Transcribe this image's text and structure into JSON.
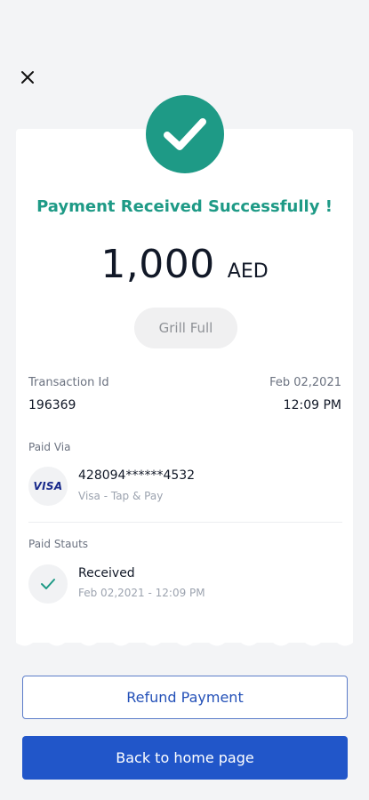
{
  "header": {
    "close_icon": "close-icon"
  },
  "status": {
    "icon": "check-circle-icon",
    "title": "Payment Received Successfully !",
    "color": "#1e9a86"
  },
  "amount": {
    "value": "1,000",
    "currency": "AED"
  },
  "merchant": {
    "name": "Grill Full"
  },
  "transaction": {
    "id_label": "Transaction Id",
    "id_value": "196369",
    "date": "Feb 02,2021",
    "time": "12:09 PM"
  },
  "paid_via": {
    "label": "Paid Via",
    "brand": "VISA",
    "card_number": "428094******4532",
    "method": "Visa - Tap & Pay"
  },
  "paid_status": {
    "label": "Paid Stauts",
    "value": "Received",
    "timestamp": "Feb 02,2021 - 12:09 PM"
  },
  "actions": {
    "refund_label": "Refund Payment",
    "home_label": "Back to home page",
    "primary_color": "#2156c9"
  }
}
